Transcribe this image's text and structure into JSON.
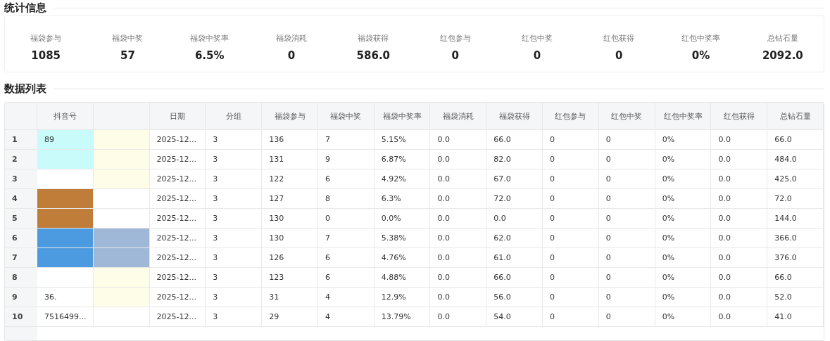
{
  "stats_section": {
    "title": "统计信息",
    "items": [
      {
        "label": "福袋参与",
        "value": "1085"
      },
      {
        "label": "福袋中奖",
        "value": "57"
      },
      {
        "label": "福袋中奖率",
        "value": "6.5%"
      },
      {
        "label": "福袋消耗",
        "value": "0"
      },
      {
        "label": "福袋获得",
        "value": "586.0"
      },
      {
        "label": "红包参与",
        "value": "0"
      },
      {
        "label": "红包中奖",
        "value": "0"
      },
      {
        "label": "红包获得",
        "value": "0"
      },
      {
        "label": "红包中奖率",
        "value": "0%"
      },
      {
        "label": "总钻石量",
        "value": "2092.0"
      }
    ]
  },
  "table_section": {
    "title": "数据列表",
    "columns": [
      "抖音号",
      "",
      "日期",
      "分组",
      "福袋参与",
      "福袋中奖",
      "福袋中奖率",
      "福袋消耗",
      "福袋获得",
      "红包参与",
      "红包中奖",
      "红包中奖率",
      "红包获得",
      "总钻石量"
    ],
    "rows": [
      {
        "index": "1",
        "cells": [
          {
            "text": "89",
            "color": "#c9fbfb"
          },
          {
            "color": "#fdfde8"
          },
          {
            "text": "2025-12..."
          },
          {
            "text": "3"
          },
          {
            "text": "136"
          },
          {
            "text": "7"
          },
          {
            "text": "5.15%"
          },
          {
            "text": "0.0"
          },
          {
            "text": "66.0"
          },
          {
            "text": "0"
          },
          {
            "text": "0"
          },
          {
            "text": "0%"
          },
          {
            "text": "0.0"
          },
          {
            "text": "66.0"
          }
        ]
      },
      {
        "index": "2",
        "cells": [
          {
            "color": "#c9fbfb"
          },
          {
            "color": "#fdfde8"
          },
          {
            "text": "2025-12..."
          },
          {
            "text": "3"
          },
          {
            "text": "131"
          },
          {
            "text": "9"
          },
          {
            "text": "6.87%"
          },
          {
            "text": "0.0"
          },
          {
            "text": "82.0"
          },
          {
            "text": "0"
          },
          {
            "text": "0"
          },
          {
            "text": "0%"
          },
          {
            "text": "0.0"
          },
          {
            "text": "484.0"
          }
        ]
      },
      {
        "index": "3",
        "cells": [
          {},
          {
            "color": "#fdfde8"
          },
          {
            "text": "2025-12..."
          },
          {
            "text": "3"
          },
          {
            "text": "122"
          },
          {
            "text": "6"
          },
          {
            "text": "4.92%"
          },
          {
            "text": "0.0"
          },
          {
            "text": "67.0"
          },
          {
            "text": "0"
          },
          {
            "text": "0"
          },
          {
            "text": "0%"
          },
          {
            "text": "0.0"
          },
          {
            "text": "425.0"
          }
        ]
      },
      {
        "index": "4",
        "cells": [
          {
            "color": "#c07d3a"
          },
          {},
          {
            "text": "2025-12..."
          },
          {
            "text": "3"
          },
          {
            "text": "127"
          },
          {
            "text": "8"
          },
          {
            "text": "6.3%"
          },
          {
            "text": "0.0"
          },
          {
            "text": "72.0"
          },
          {
            "text": "0"
          },
          {
            "text": "0"
          },
          {
            "text": "0%"
          },
          {
            "text": "0.0"
          },
          {
            "text": "72.0"
          }
        ]
      },
      {
        "index": "5",
        "cells": [
          {
            "color": "#c07d3a"
          },
          {},
          {
            "text": "2025-12..."
          },
          {
            "text": "3"
          },
          {
            "text": "130"
          },
          {
            "text": "0"
          },
          {
            "text": "0.0%"
          },
          {
            "text": "0.0"
          },
          {
            "text": "0.0"
          },
          {
            "text": "0"
          },
          {
            "text": "0"
          },
          {
            "text": "0%"
          },
          {
            "text": "0.0"
          },
          {
            "text": "144.0"
          }
        ]
      },
      {
        "index": "6",
        "cells": [
          {
            "color": "#4c9be0"
          },
          {
            "color": "#9fb8d8"
          },
          {
            "text": "2025-12..."
          },
          {
            "text": "3"
          },
          {
            "text": "130"
          },
          {
            "text": "7"
          },
          {
            "text": "5.38%"
          },
          {
            "text": "0.0"
          },
          {
            "text": "62.0"
          },
          {
            "text": "0"
          },
          {
            "text": "0"
          },
          {
            "text": "0%"
          },
          {
            "text": "0.0"
          },
          {
            "text": "366.0"
          }
        ]
      },
      {
        "index": "7",
        "cells": [
          {
            "color": "#4c9be0"
          },
          {
            "color": "#9fb8d8"
          },
          {
            "text": "2025-12..."
          },
          {
            "text": "3"
          },
          {
            "text": "126"
          },
          {
            "text": "6"
          },
          {
            "text": "4.76%"
          },
          {
            "text": "0.0"
          },
          {
            "text": "61.0"
          },
          {
            "text": "0"
          },
          {
            "text": "0"
          },
          {
            "text": "0%"
          },
          {
            "text": "0.0"
          },
          {
            "text": "376.0"
          }
        ]
      },
      {
        "index": "8",
        "cells": [
          {},
          {
            "color": "#fdfde8"
          },
          {
            "text": "2025-12..."
          },
          {
            "text": "3"
          },
          {
            "text": "123"
          },
          {
            "text": "6"
          },
          {
            "text": "4.88%"
          },
          {
            "text": "0.0"
          },
          {
            "text": "66.0"
          },
          {
            "text": "0"
          },
          {
            "text": "0"
          },
          {
            "text": "0%"
          },
          {
            "text": "0.0"
          },
          {
            "text": "66.0"
          }
        ]
      },
      {
        "index": "9",
        "cells": [
          {
            "text": "36."
          },
          {
            "color": "#fdfde8"
          },
          {
            "text": "2025-12..."
          },
          {
            "text": "3"
          },
          {
            "text": "31"
          },
          {
            "text": "4"
          },
          {
            "text": "12.9%"
          },
          {
            "text": "0.0"
          },
          {
            "text": "56.0"
          },
          {
            "text": "0"
          },
          {
            "text": "0"
          },
          {
            "text": "0%"
          },
          {
            "text": "0.0"
          },
          {
            "text": "52.0"
          }
        ]
      },
      {
        "index": "10",
        "cells": [
          {
            "text": "7516499..."
          },
          {},
          {
            "text": "2025-12..."
          },
          {
            "text": "3"
          },
          {
            "text": "29"
          },
          {
            "text": "4"
          },
          {
            "text": "13.79%"
          },
          {
            "text": "0.0"
          },
          {
            "text": "54.0"
          },
          {
            "text": "0"
          },
          {
            "text": "0"
          },
          {
            "text": "0%"
          },
          {
            "text": "0.0"
          },
          {
            "text": "41.0"
          }
        ]
      }
    ]
  }
}
